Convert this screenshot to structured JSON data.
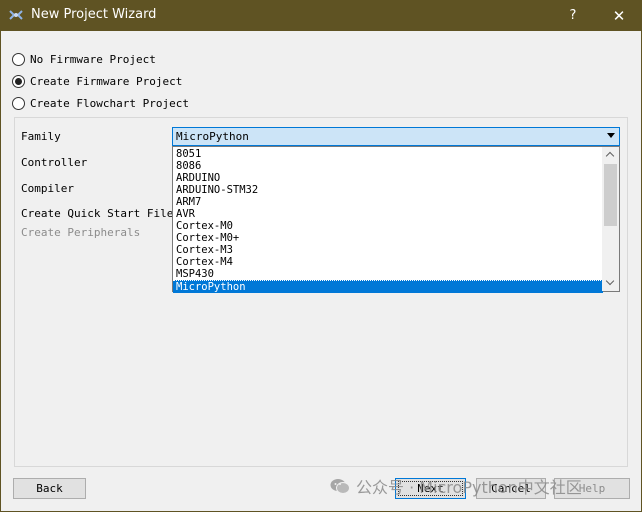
{
  "window": {
    "title": "New Project Wizard",
    "help_label": "?",
    "close_label": "✕",
    "icon": "wizard-app-icon"
  },
  "project_types": [
    {
      "label": "No Firmware Project",
      "checked": false
    },
    {
      "label": "Create Firmware Project",
      "checked": true
    },
    {
      "label": "Create Flowchart Project",
      "checked": false
    }
  ],
  "fields": {
    "family": "Family",
    "controller": "Controller",
    "compiler": "Compiler",
    "quick_start": "Create Quick Start Files",
    "peripherals": "Create Peripherals"
  },
  "family_combo": {
    "value": "MicroPython",
    "options": [
      "8051",
      "8086",
      "ARDUINO",
      "ARDUINO-STM32",
      "ARM7",
      "AVR",
      "Cortex-M0",
      "Cortex-M0+",
      "Cortex-M3",
      "Cortex-M4",
      "MSP430",
      "MicroPython"
    ],
    "selected_index": 11
  },
  "buttons": {
    "back": "Back",
    "next": "Next",
    "cancel": "Cancel",
    "help": "Help"
  },
  "watermark": {
    "text": "公众号 · MicroPython中文社区",
    "icon": "wechat-icon"
  },
  "colors": {
    "titlebar": "#5f5323",
    "accent": "#0078d7",
    "combo_bg": "#cce4f7"
  }
}
